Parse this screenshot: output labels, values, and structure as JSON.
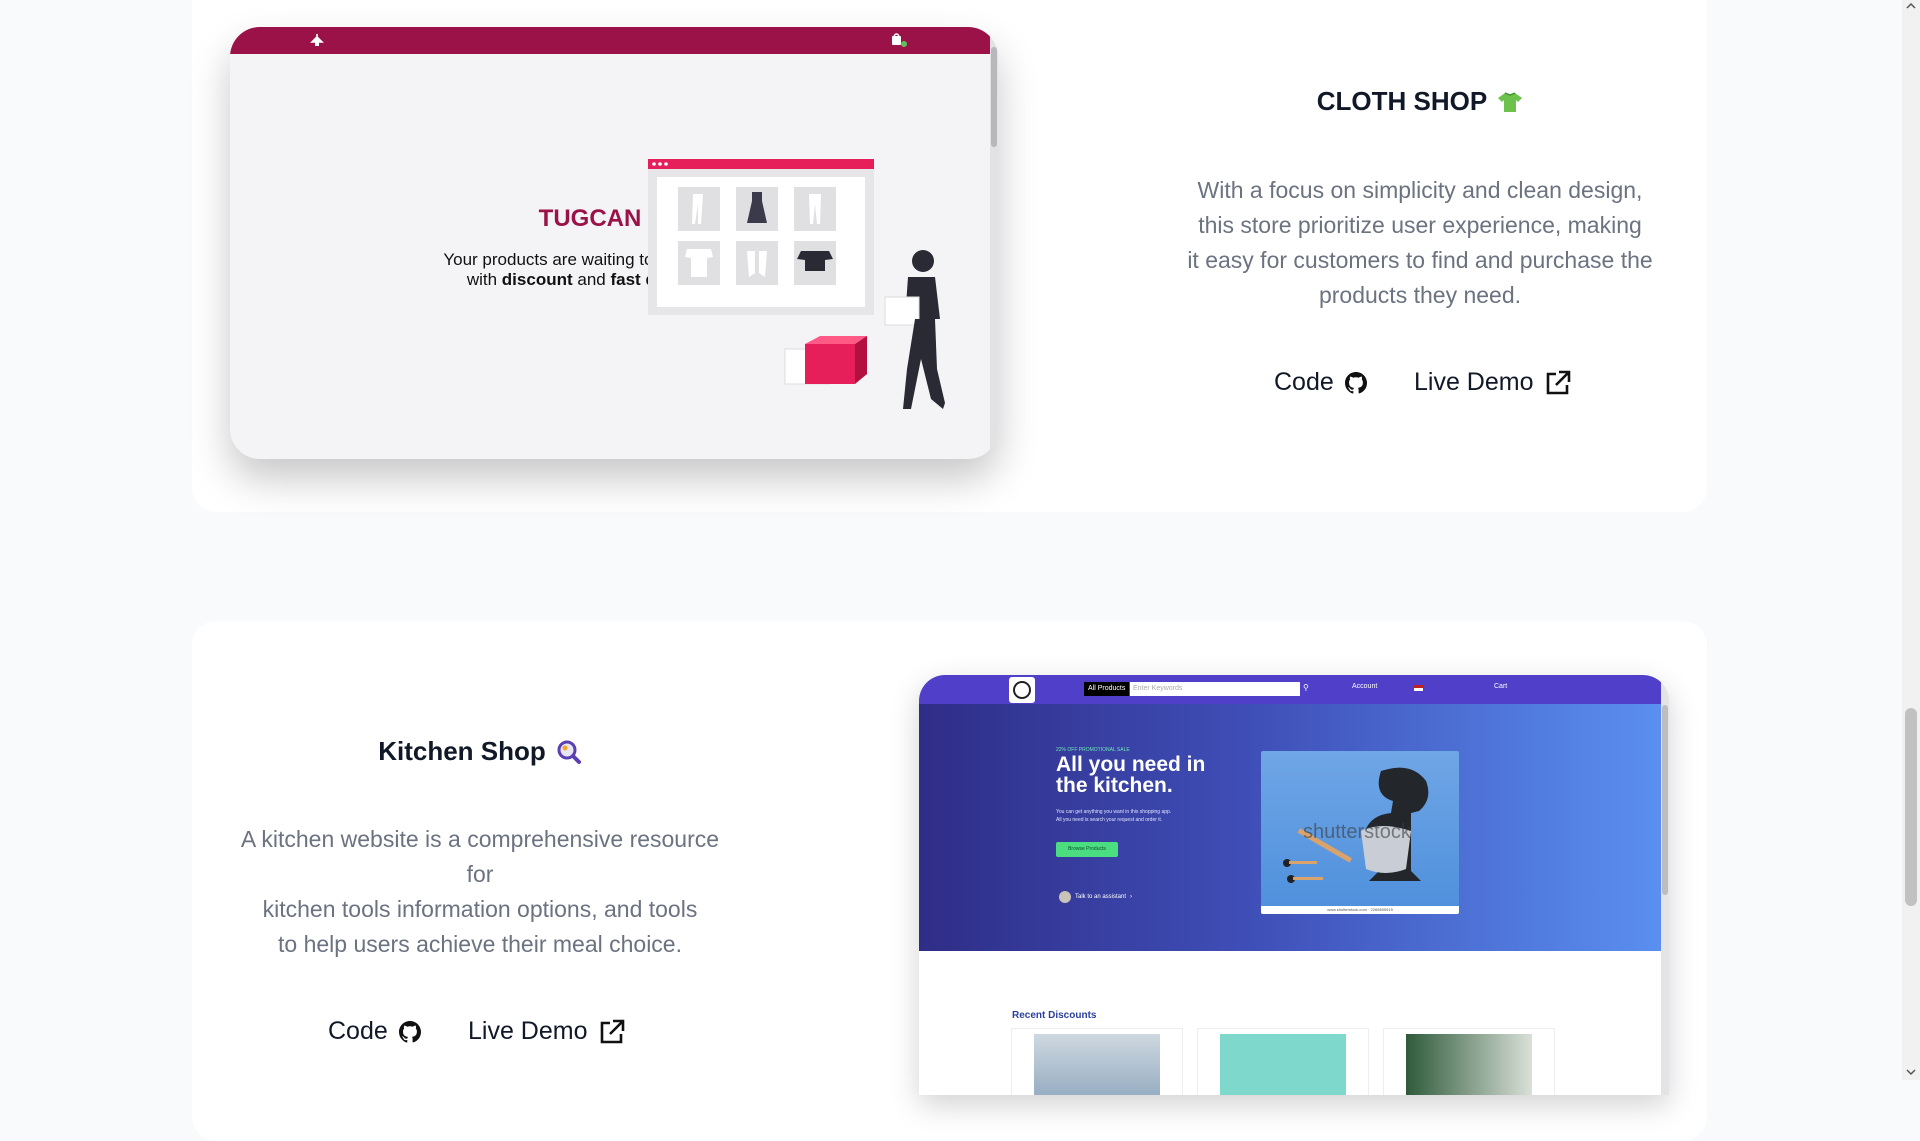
{
  "projects": [
    {
      "title": "CLOTH SHOP",
      "title_icon": "t-shirt-icon",
      "description_lines": [
        "With a focus on simplicity and clean design,",
        "this store prioritize user experience, making",
        "it easy for customers to find and purchase the",
        "products they need."
      ],
      "code_label": "Code",
      "demo_label": "Live Demo",
      "preview": {
        "brand": "TUGCAN",
        "tagline_line1": "Your products are waiting to be packed",
        "tagline_with": "with",
        "tagline_discount": "discount",
        "tagline_and": "and",
        "tagline_fast": "fast delivery.",
        "bar_color": "#9b1248"
      }
    },
    {
      "title": "Kitchen Shop",
      "title_icon": "search-icon",
      "description_lines": [
        "A kitchen website is a comprehensive resource",
        "for",
        "kitchen tools information options, and tools",
        "to help users achieve their meal choice."
      ],
      "code_label": "Code",
      "demo_label": "Live Demo",
      "preview": {
        "nav_all_products": "All Products",
        "nav_search_placeholder": "Enter Keywords",
        "nav_account": "Account",
        "nav_cart": "Cart",
        "promo": "22% OFF PROMOTIONAL SALE",
        "headline_line1": "All you need in",
        "headline_line2": "the kitchen.",
        "sub_line1": "You can get anything you want in this shopping app.",
        "sub_line2": "All you need is search your request and order it.",
        "browse_button": "Browse Products",
        "assistant": "Talk to an assistant",
        "watermark": "shutterstock",
        "image_caption": "www.shutterstock.com · 2265695915",
        "recent_discounts": "Recent Discounts"
      }
    }
  ],
  "colors": {
    "accent_magenta": "#9b1248",
    "kitchen_nav": "#4f3fc9",
    "text_dark": "#111827",
    "text_muted": "#6b7280"
  }
}
